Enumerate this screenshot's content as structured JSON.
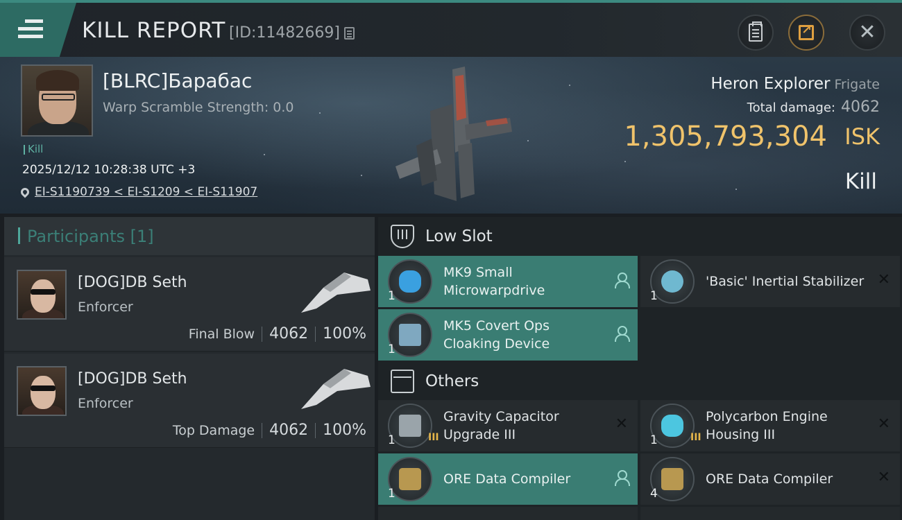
{
  "header": {
    "title": "KILL REPORT",
    "report_id": "[ID:11482669]"
  },
  "victim": {
    "name": "[BLRC]Барабас",
    "warp_scramble": "Warp Scramble Strength: 0.0",
    "tag": "Kill",
    "datetime": "2025/12/12 10:28:38 UTC +3",
    "location": "EI-S1190739 < EI-S1209 < EI-S11907",
    "ship_name": "Heron Explorer",
    "ship_class": "Frigate",
    "total_damage_label": "Total damage:",
    "total_damage": "4062",
    "isk_value": "1,305,793,304",
    "isk_unit": "ISK",
    "result": "Kill"
  },
  "participants": {
    "header": "Participants [1]",
    "list": [
      {
        "name": "[DOG]DB Seth",
        "ship": "Enforcer",
        "role": "Final Blow",
        "damage": "4062",
        "percent": "100%"
      },
      {
        "name": "[DOG]DB Seth",
        "ship": "Enforcer",
        "role": "Top Damage",
        "damage": "4062",
        "percent": "100%"
      }
    ]
  },
  "items": {
    "low_slot_label": "Low Slot",
    "others_label": "Others",
    "low_slot": [
      {
        "name": "MK9 Small Microwarpdrive",
        "qty": "1",
        "tier": "",
        "status": "person",
        "color": "#3aa0e0"
      },
      {
        "name": "'Basic' Inertial Stabilizer",
        "qty": "1",
        "tier": "",
        "status": "x",
        "color": "#6fb8d0"
      },
      {
        "name": "MK5 Covert Ops Cloaking Device",
        "qty": "1",
        "tier": "",
        "status": "person",
        "color": "#7fa8c0"
      }
    ],
    "others": [
      {
        "name": "Gravity Capacitor Upgrade III",
        "qty": "1",
        "tier": "III",
        "status": "x",
        "color": "#9aa4aa"
      },
      {
        "name": "Polycarbon Engine Housing III",
        "qty": "1",
        "tier": "III",
        "status": "x",
        "color": "#4cc6e0"
      },
      {
        "name": "ORE Data Compiler",
        "qty": "1",
        "tier": "",
        "status": "person",
        "color": "#b89850"
      },
      {
        "name": "ORE Data Compiler",
        "qty": "4",
        "tier": "",
        "status": "x",
        "color": "#b89850"
      }
    ]
  },
  "colors": {
    "accent": "#3a7d73",
    "isk": "#f0c36b"
  }
}
